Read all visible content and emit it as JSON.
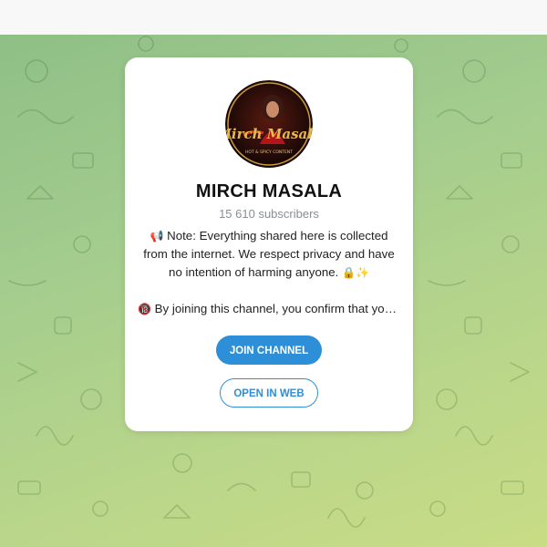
{
  "channel": {
    "title": "MIRCH MASALA",
    "subscribers": "15 610 subscribers",
    "avatar_text": "Mirch Masala",
    "avatar_tagline": "HOT & SPICY CONTENT",
    "description_line1_icon": "megaphone-icon",
    "description_line1": "Note: Everything shared here is collected from the internet. We respect privacy and have no intention of harming anyone.",
    "description_line1_emojis": "🔒✨",
    "description_line2_icon": "under-18-icon",
    "description_line2": "By joining this channel, you confirm that you ar…"
  },
  "buttons": {
    "join": "JOIN CHANNEL",
    "open_web": "OPEN IN WEB"
  },
  "colors": {
    "accent": "#2d8fd8",
    "background_green": "#a3cc8e"
  }
}
